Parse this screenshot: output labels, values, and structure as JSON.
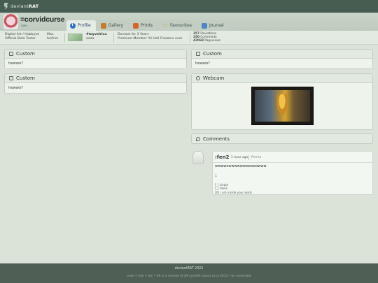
{
  "topbar": {
    "logo_plain": "deviant",
    "logo_bold": "RAT"
  },
  "profile": {
    "username": "=corvidcurse",
    "tagline": "owo",
    "tabs": [
      {
        "label": "Profile",
        "icon": "info-icon",
        "active": true
      },
      {
        "label": "Gallery",
        "icon": "gallery-icon"
      },
      {
        "label": "Prints",
        "icon": "prints-icon"
      },
      {
        "label": "Favourites",
        "icon": "star-icon"
      },
      {
        "label": "Journal",
        "icon": "journal-icon"
      }
    ]
  },
  "infobar": {
    "role_line1": "Digital Art / Hobbyist",
    "role_line2": "Official Beta Tester",
    "name_line1": "Max",
    "name_line2": "he/him",
    "badge_tag": "#myvelrica",
    "badge_sub": "aaaa",
    "member_line1": "Deviant for 3 Years",
    "member_line2": "Premium Member 'til Hell Freezers over",
    "stats": [
      {
        "num": "357",
        "label": "Deviations"
      },
      {
        "num": "250",
        "label": "Comments"
      },
      {
        "num": "42069",
        "label": "Pageviews"
      }
    ]
  },
  "widgets": {
    "custom1": {
      "title": "Custom",
      "body": "hewwo?"
    },
    "custom2": {
      "title": "Custom",
      "body": "hewwo?"
    },
    "custom3": {
      "title": "Custom",
      "body": "hewwo?"
    },
    "webcam": {
      "title": "Webcam"
    },
    "comments": {
      "title": "Comments"
    }
  },
  "comment": {
    "author": ":fen2",
    "time": "1 hour ago",
    "permalink": "Perma",
    "text": "wwwwowwwwwwowowowww",
    "number": "1",
    "options": [
      "[_] single",
      "[_] taken",
      "[X] i am inside your walls"
    ]
  },
  "footer": {
    "line1": "deviantRAT 2022",
    "line2": "code + info + etc  •  dR is a remake of dA's profile layout circa 2013  •  by melonebic"
  },
  "colors": {
    "topbar": "#475d52",
    "accent": "#2f6fc9",
    "footer": "#4f5f56"
  }
}
